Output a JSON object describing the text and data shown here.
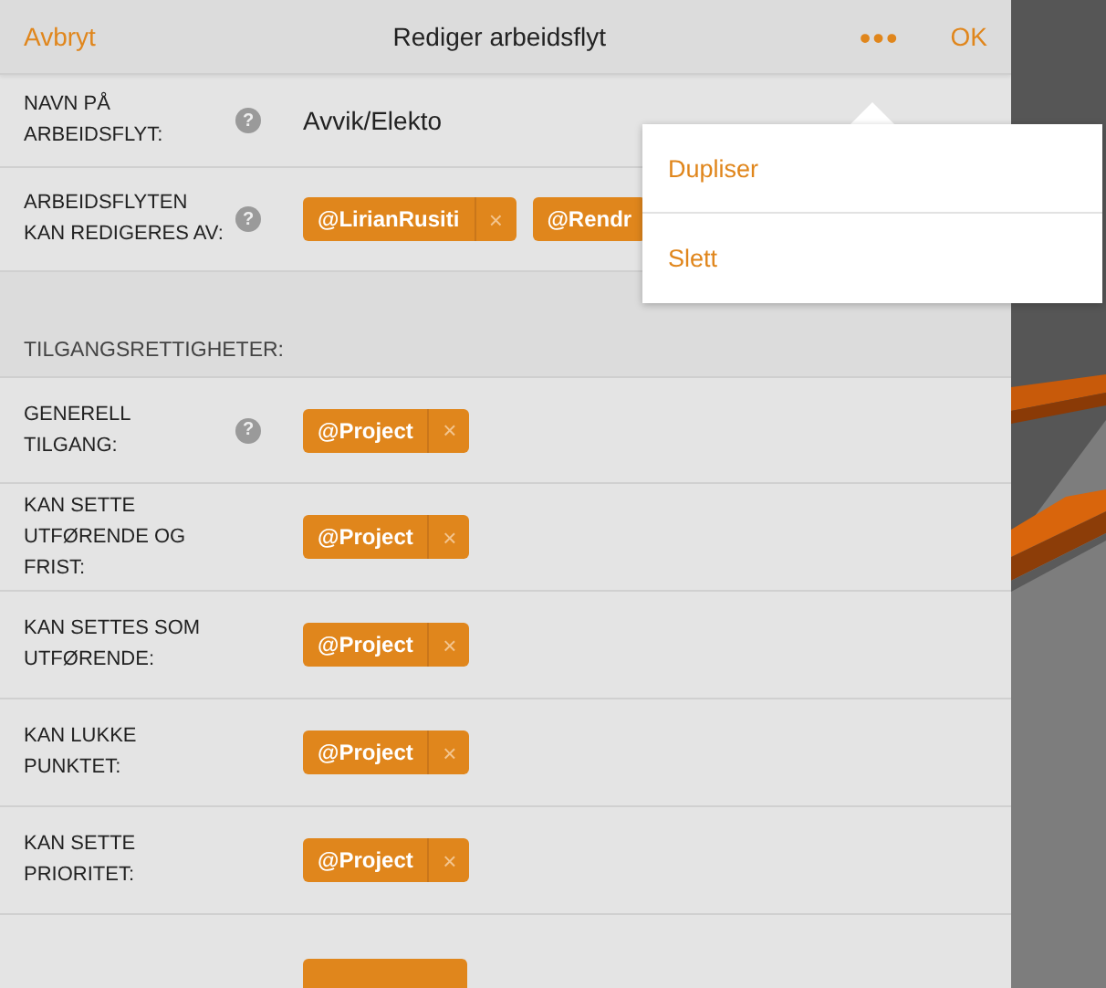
{
  "header": {
    "cancel": "Avbryt",
    "title": "Rediger arbeidsflyt",
    "more": "•••",
    "ok": "OK"
  },
  "menu": {
    "items": [
      "Dupliser",
      "Slett"
    ]
  },
  "fields": [
    {
      "label": "NAVN PÅ ARBEIDSFLYT:",
      "help": "?",
      "kind": "text",
      "value": "Avvik/Elekto"
    },
    {
      "label": "ARBEIDSFLYTEN KAN REDIGERES AV:",
      "help": "?",
      "kind": "tags",
      "tags": [
        {
          "text": "@LirianRusiti",
          "remove": "×"
        },
        {
          "text": "@Rendr"
        }
      ]
    }
  ],
  "section": {
    "heading": "TILGANGSRETTIGHETER:"
  },
  "rights": [
    {
      "label": "GENERELL TILGANG:",
      "help": "?",
      "tags": [
        {
          "text": "@Project",
          "remove": "×"
        }
      ]
    },
    {
      "label": "KAN SETTE UTFØRENDE OG FRIST:",
      "tags": [
        {
          "text": "@Project",
          "remove": "×"
        }
      ]
    },
    {
      "label": "KAN SETTES SOM UTFØRENDE:",
      "tags": [
        {
          "text": "@Project",
          "remove": "×"
        }
      ]
    },
    {
      "label": "KAN LUKKE PUNKTET:",
      "tags": [
        {
          "text": "@Project",
          "remove": "×"
        }
      ]
    },
    {
      "label": "KAN SETTE PRIORITET:",
      "tags": [
        {
          "text": "@Project",
          "remove": "×"
        }
      ]
    }
  ]
}
